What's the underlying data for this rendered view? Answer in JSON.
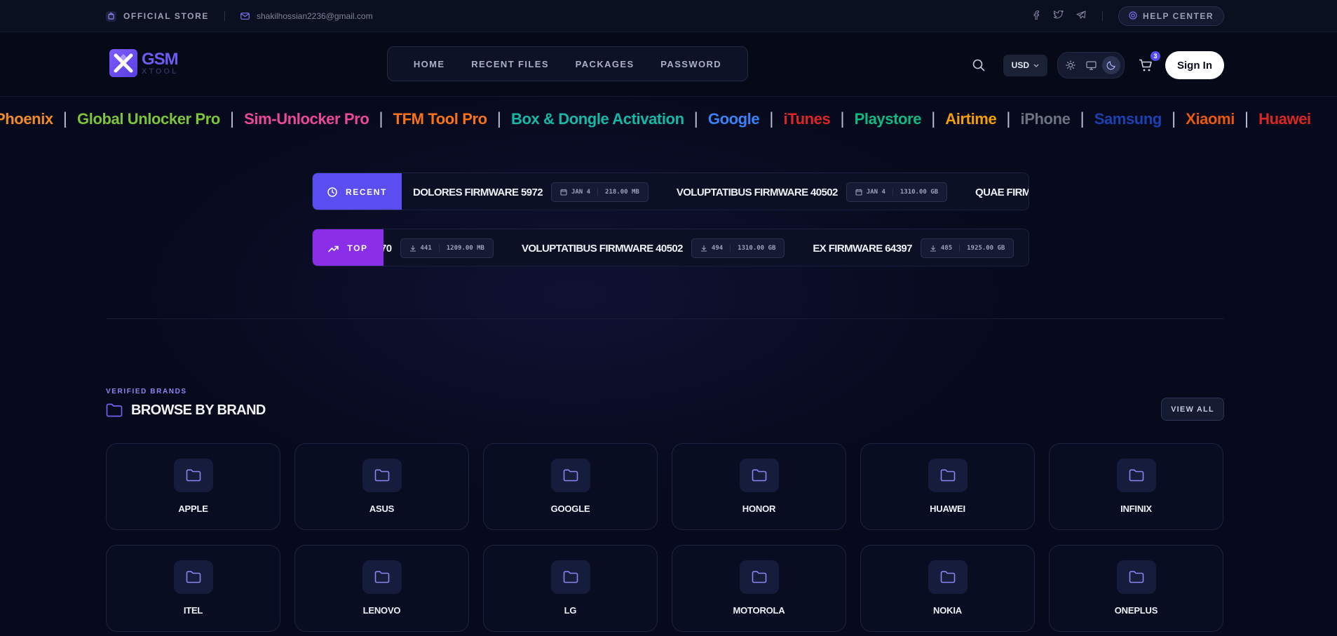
{
  "topbar": {
    "store_label": "OFFICIAL STORE",
    "email": "shakilhossian2236@gmail.com",
    "social_icons": [
      "facebook-icon",
      "twitter-icon",
      "telegram-icon"
    ],
    "help_label": "HELP CENTER"
  },
  "header": {
    "logo": {
      "title": "GSM",
      "subtitle": "XTOOL"
    },
    "nav": [
      "HOME",
      "RECENT FILES",
      "PACKAGES",
      "PASSWORD"
    ],
    "currency": "USD",
    "theme_options": [
      "light",
      "system",
      "dark"
    ],
    "active_theme": "dark",
    "cart_count": "3",
    "signin_label": "Sign In"
  },
  "ticker": {
    "items": [
      {
        "label": "Phoenix",
        "color": "#f08a2a"
      },
      {
        "label": "Global Unlocker Pro",
        "color": "#7cc43a"
      },
      {
        "label": "Sim-Unlocker Pro",
        "color": "#ec4899"
      },
      {
        "label": "TFM Tool Pro",
        "color": "#f97316"
      },
      {
        "label": "Box & Dongle Activation",
        "color": "#14b8a6"
      },
      {
        "label": "Google",
        "color": "#3b82f6"
      },
      {
        "label": "iTunes",
        "color": "#dc2626"
      },
      {
        "label": "Playstore",
        "color": "#10b981"
      },
      {
        "label": "Airtime",
        "color": "#f59e0b"
      },
      {
        "label": "iPhone",
        "color": "#6b7280"
      },
      {
        "label": "Samsung",
        "color": "#1e40af"
      },
      {
        "label": "Xiaomi",
        "color": "#ea580c"
      },
      {
        "label": "Huawei",
        "color": "#dc2626"
      }
    ]
  },
  "recent_feed": {
    "label": "RECENT",
    "accent": "#5b4ef0",
    "items": [
      {
        "name": "DOLORES FIRMWARE 5972",
        "date": "JAN 4",
        "size": "218.00 MB"
      },
      {
        "name": "VOLUPTATIBUS FIRMWARE 40502",
        "date": "JAN 4",
        "size": "1310.00 GB"
      },
      {
        "name": "QUAE FIRMWARE",
        "date": "",
        "size": ""
      }
    ]
  },
  "top_feed": {
    "label": "TOP",
    "accent": "#8b2ee8",
    "lead_fragment": "70",
    "lead_downloads": "441",
    "lead_size": "1209.00 MB",
    "items": [
      {
        "name": "VOLUPTATIBUS FIRMWARE 40502",
        "downloads": "494",
        "size": "1310.00 GB"
      },
      {
        "name": "EX FIRMWARE 64397",
        "downloads": "485",
        "size": "1925.00 GB"
      }
    ]
  },
  "brands": {
    "eyebrow": "VERIFIED BRANDS",
    "title": "BROWSE BY BRAND",
    "view_all": "VIEW ALL",
    "list": [
      "APPLE",
      "ASUS",
      "GOOGLE",
      "HONOR",
      "HUAWEI",
      "INFINIX",
      "ITEL",
      "LENOVO",
      "LG",
      "MOTOROLA",
      "NOKIA",
      "ONEPLUS"
    ]
  }
}
